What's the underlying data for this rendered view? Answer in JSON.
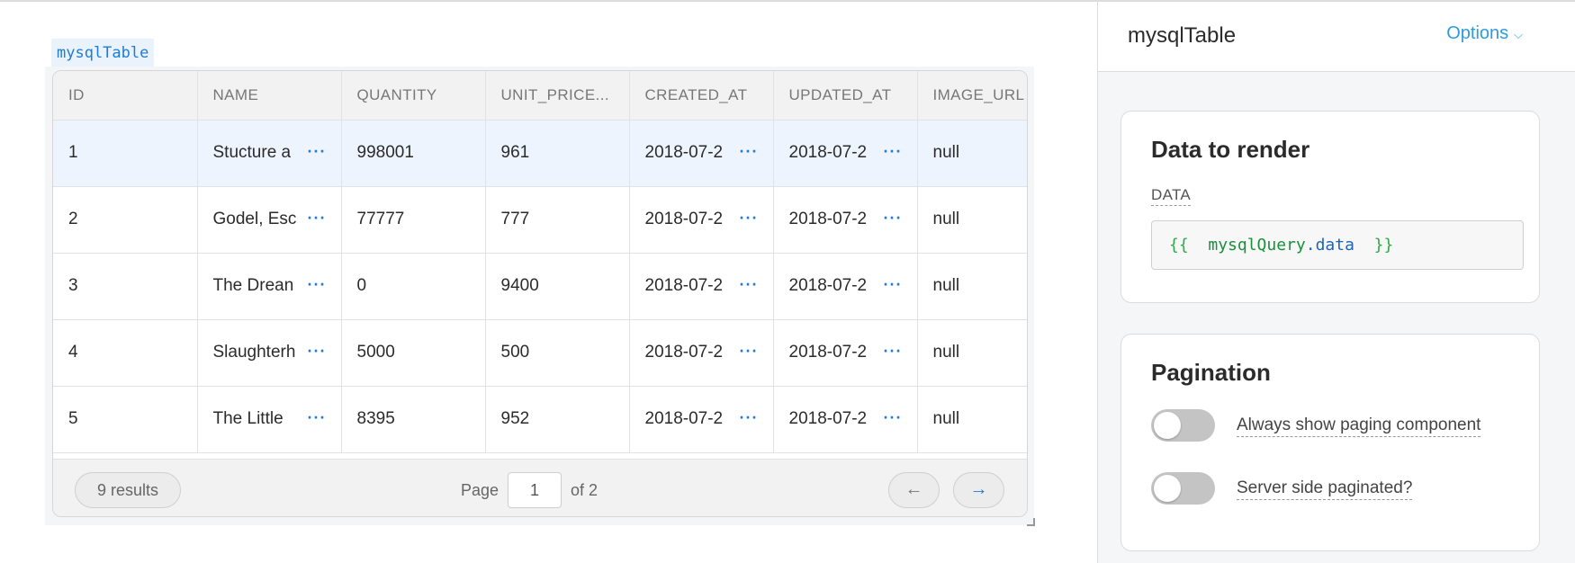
{
  "widget": {
    "name": "mysqlTable"
  },
  "table": {
    "columns": [
      "ID",
      "NAME",
      "QUANTITY",
      "UNIT_PRICE...",
      "CREATED_AT",
      "UPDATED_AT",
      "IMAGE_URL"
    ],
    "rows": [
      {
        "id": "1",
        "name": "Stucture a",
        "quantity": "998001",
        "unit_price": "961",
        "created_at": "2018-07-2",
        "updated_at": "2018-07-2",
        "image_url": "null"
      },
      {
        "id": "2",
        "name": "Godel, Esc",
        "quantity": "77777",
        "unit_price": "777",
        "created_at": "2018-07-2",
        "updated_at": "2018-07-2",
        "image_url": "null"
      },
      {
        "id": "3",
        "name": "The Drean",
        "quantity": "0",
        "unit_price": "9400",
        "created_at": "2018-07-2",
        "updated_at": "2018-07-2",
        "image_url": "null"
      },
      {
        "id": "4",
        "name": "Slaughterh",
        "quantity": "5000",
        "unit_price": "500",
        "created_at": "2018-07-2",
        "updated_at": "2018-07-2",
        "image_url": "null"
      },
      {
        "id": "5",
        "name": "The Little",
        "quantity": "8395",
        "unit_price": "952",
        "created_at": "2018-07-2",
        "updated_at": "2018-07-2",
        "image_url": "null"
      }
    ],
    "more_glyph": "···",
    "footer": {
      "results": "9 results",
      "page_label": "Page",
      "page_value": "1",
      "of_label": "of 2",
      "prev_icon": "←",
      "next_icon": "→"
    }
  },
  "inspector": {
    "title": "mysqlTable",
    "options_label": "Options",
    "options_chevron": "⌵",
    "data_section": {
      "title": "Data to render",
      "field_label": "DATA",
      "code": {
        "open": "{{",
        "variable": "mysqlQuery",
        "dot": ".",
        "property": "data",
        "close": "}}"
      }
    },
    "pagination_section": {
      "title": "Pagination",
      "toggles": [
        {
          "label": "Always show paging component",
          "enabled": false
        },
        {
          "label": "Server side paginated?",
          "enabled": false
        }
      ]
    }
  },
  "colors": {
    "accent": "#2e9be0",
    "link": "#1f7bd6",
    "code_green": "#2eaa4a",
    "selected_row": "#eef4fd"
  }
}
